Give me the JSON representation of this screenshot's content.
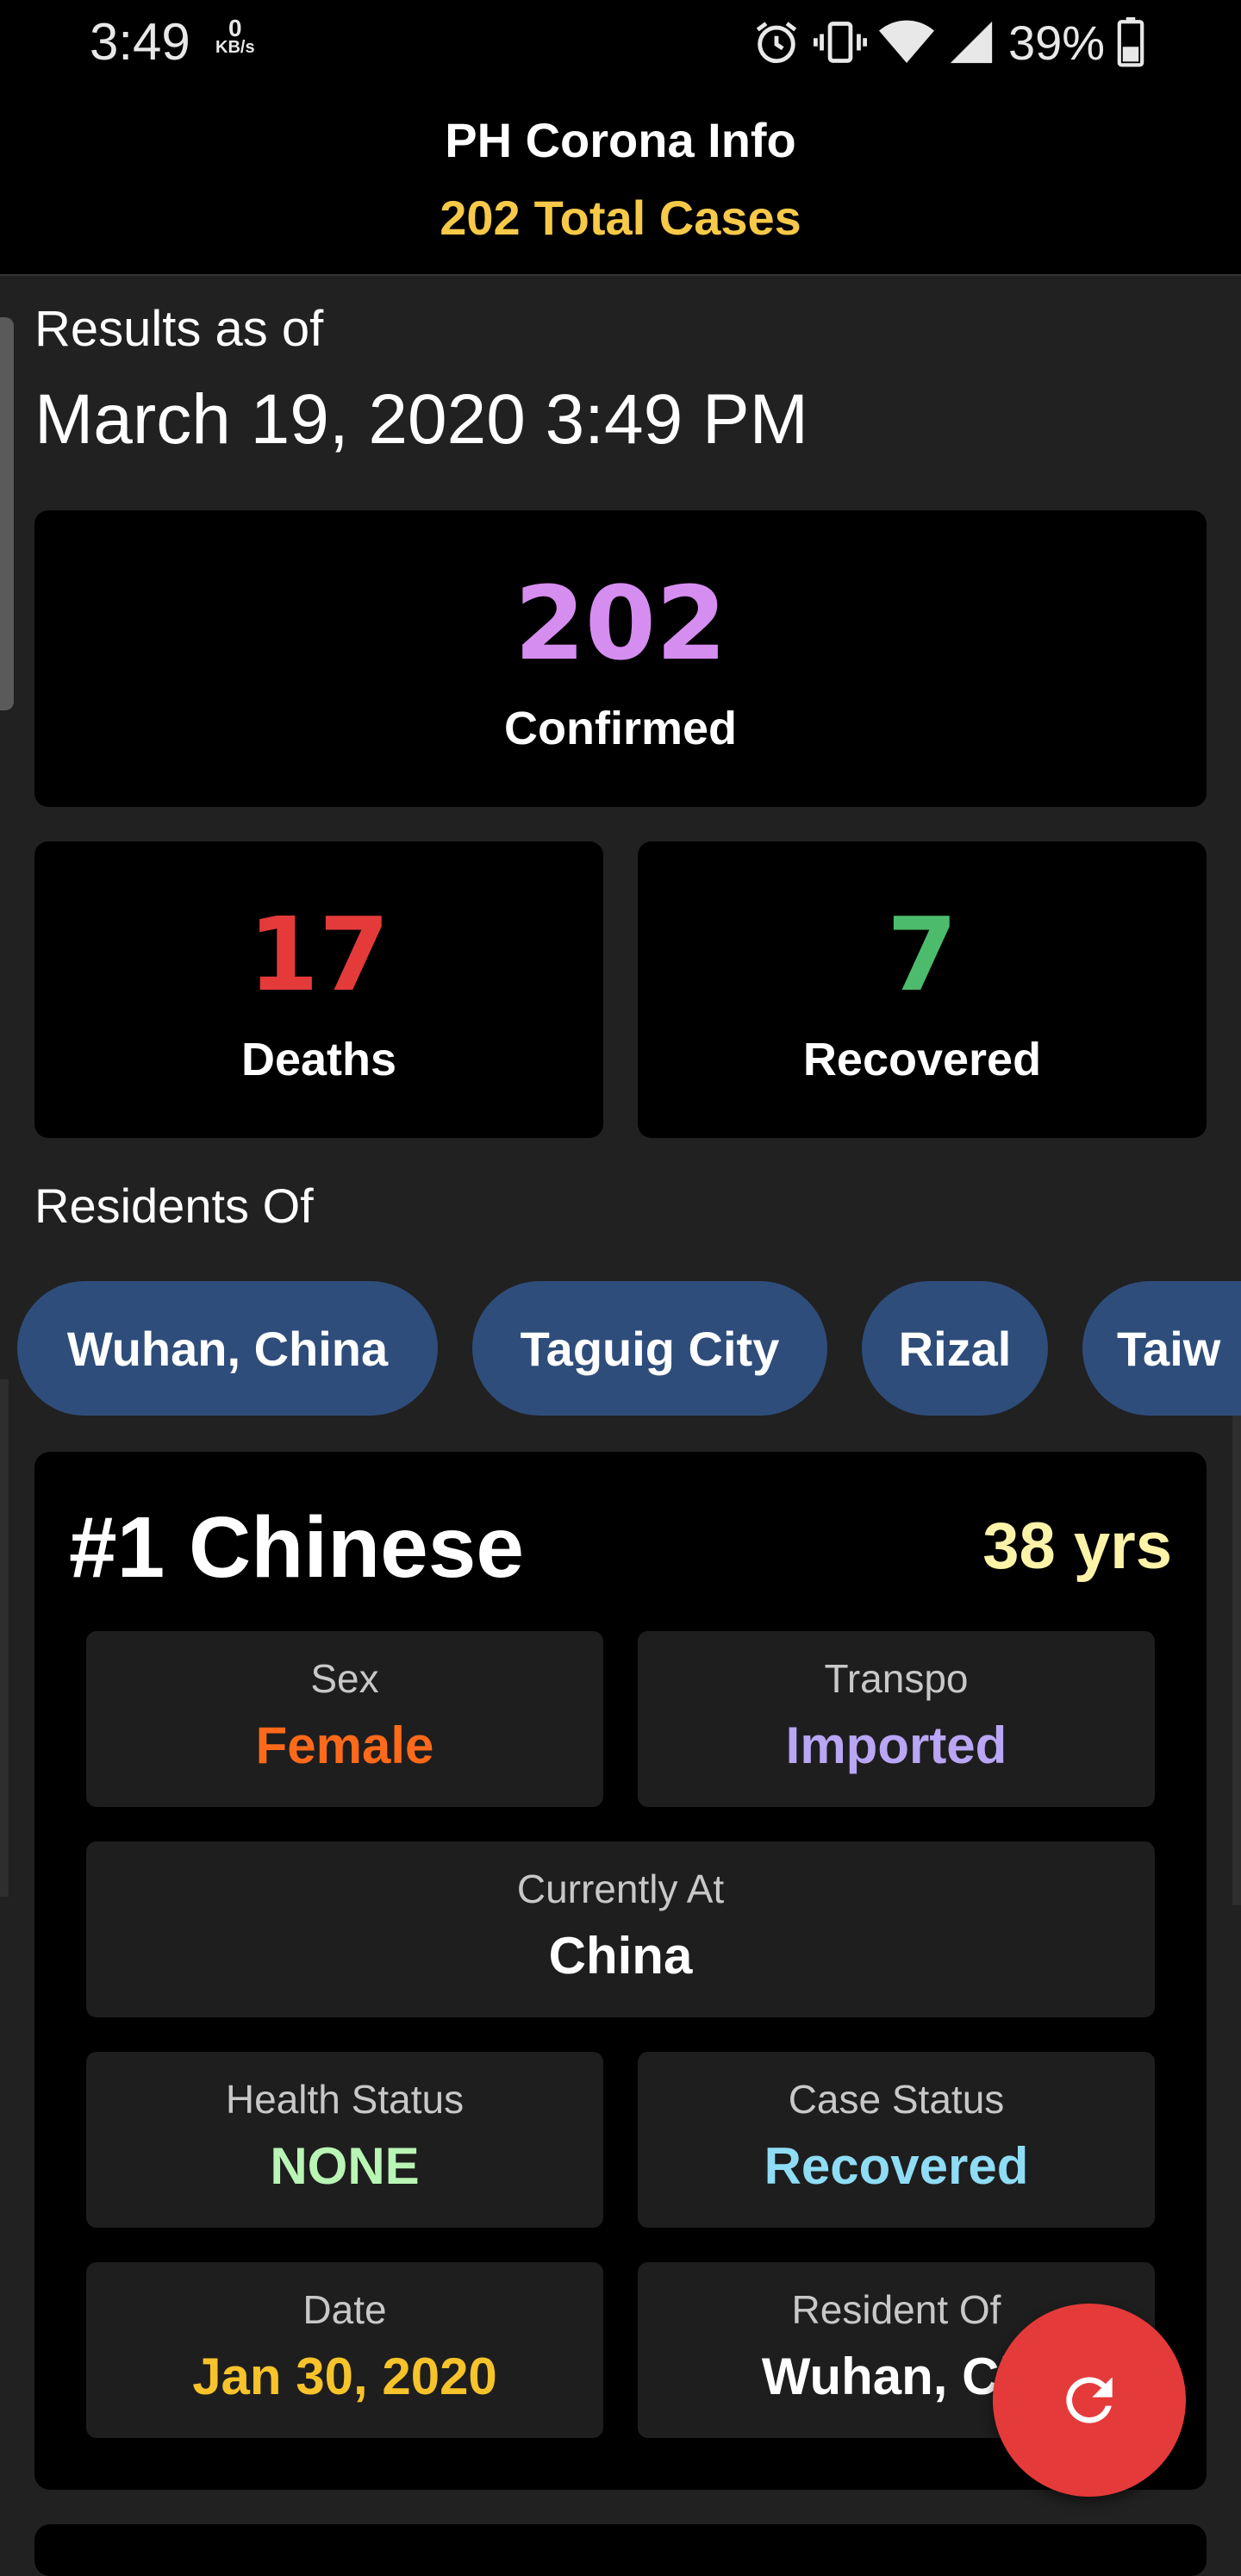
{
  "status_bar": {
    "time": "3:49",
    "net_speed_value": "0",
    "net_speed_unit": "KB/s",
    "battery": "39%",
    "icons": [
      "alarm-icon",
      "vibrate-icon",
      "wifi-icon",
      "signal-icon",
      "battery-icon"
    ]
  },
  "app": {
    "title": "PH Corona Info",
    "total_count": "202",
    "total_label": "Total Cases"
  },
  "results": {
    "label": "Results as of",
    "date": "March 19, 2020 3:49 PM"
  },
  "stats": {
    "confirmed": {
      "value": "202",
      "label": "Confirmed",
      "color": "#d68df0"
    },
    "deaths": {
      "value": "17",
      "label": "Deaths",
      "color": "#e53a3a"
    },
    "recovered": {
      "value": "7",
      "label": "Recovered",
      "color": "#4cbb6c"
    }
  },
  "residents": {
    "label": "Residents Of",
    "chips": [
      "Wuhan, China",
      "Taguig City",
      "Rizal",
      "Taiw"
    ]
  },
  "case": {
    "title": "#1 Chinese",
    "age": "38 yrs",
    "fields": {
      "sex": {
        "label": "Sex",
        "value": "Female",
        "color": "#ff6a1a"
      },
      "transpo": {
        "label": "Transpo",
        "value": "Imported",
        "color": "#b9a6f5"
      },
      "currently_at": {
        "label": "Currently At",
        "value": "China",
        "color": "#ffffff"
      },
      "health_status": {
        "label": "Health Status",
        "value": "NONE",
        "color": "#b9f5b4"
      },
      "case_status": {
        "label": "Case Status",
        "value": "Recovered",
        "color": "#8fdcf5"
      },
      "date": {
        "label": "Date",
        "value": "Jan 30, 2020",
        "color": "#f7c32a"
      },
      "resident_of": {
        "label": "Resident Of",
        "value": "Wuhan, Ch",
        "color": "#ffffff"
      }
    }
  },
  "fab": {
    "icon": "refresh-icon"
  }
}
